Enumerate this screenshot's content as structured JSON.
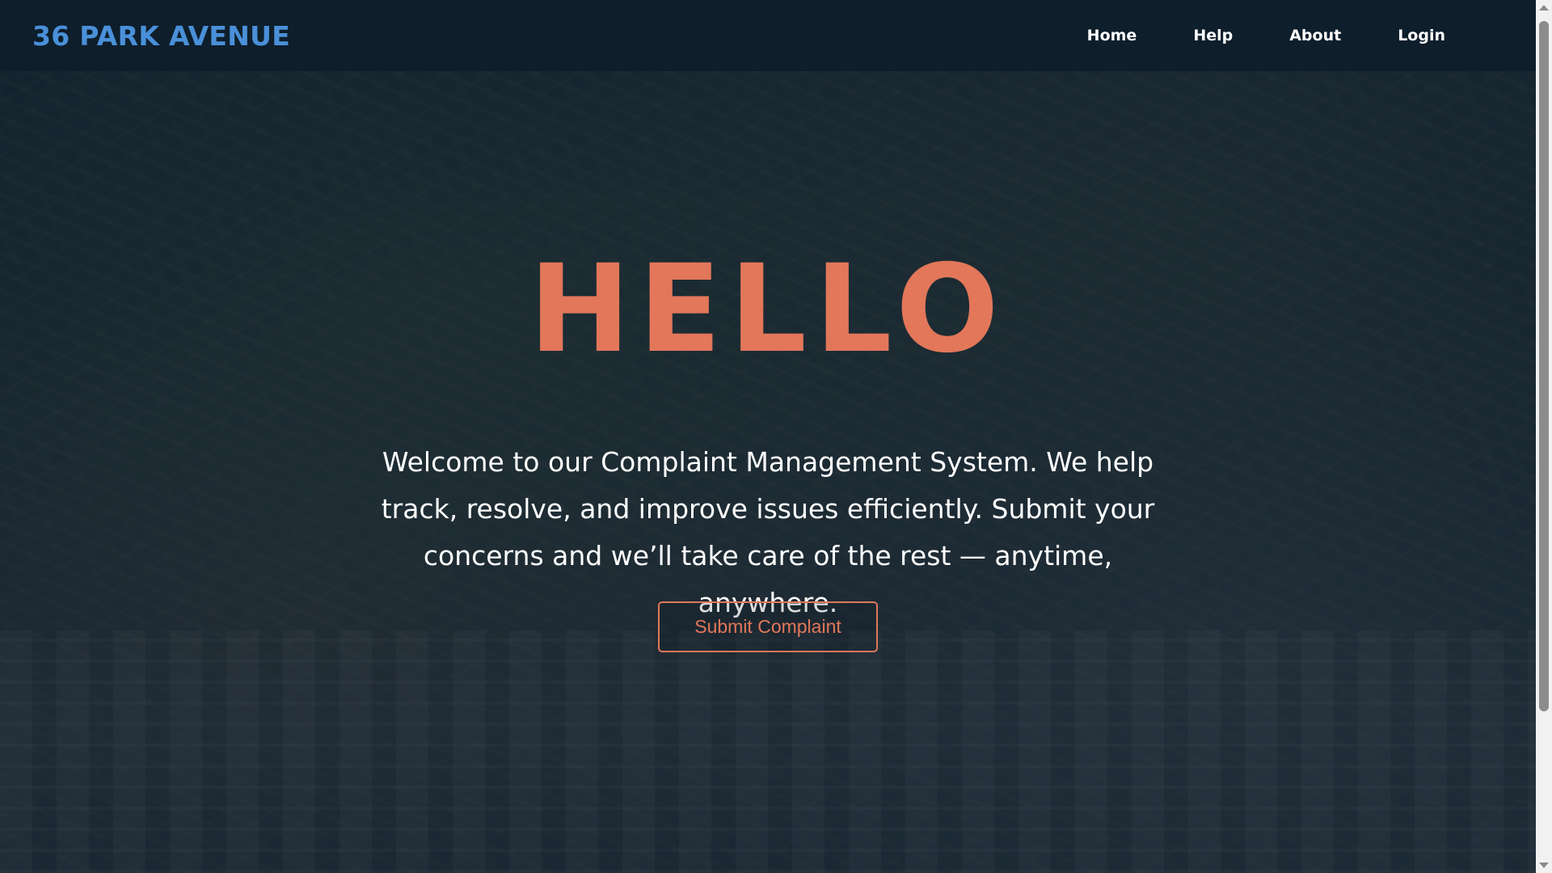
{
  "navbar": {
    "brand": "36 PARK AVENUE",
    "links": [
      "Home",
      "Help",
      "About",
      "Login"
    ]
  },
  "hero": {
    "title": "HELLO",
    "text": "Welcome to our Complaint Management System. We help track, resolve, and improve issues efficiently. Submit your concerns and we’ll take care of the rest — anytime, anywhere.",
    "cta_label": "Submit Complaint",
    "background": "aerial-city-photo"
  },
  "colors": {
    "brand": "#4a90d9",
    "accent": "#e2775a",
    "nav_bg": "#0e1e2b"
  }
}
